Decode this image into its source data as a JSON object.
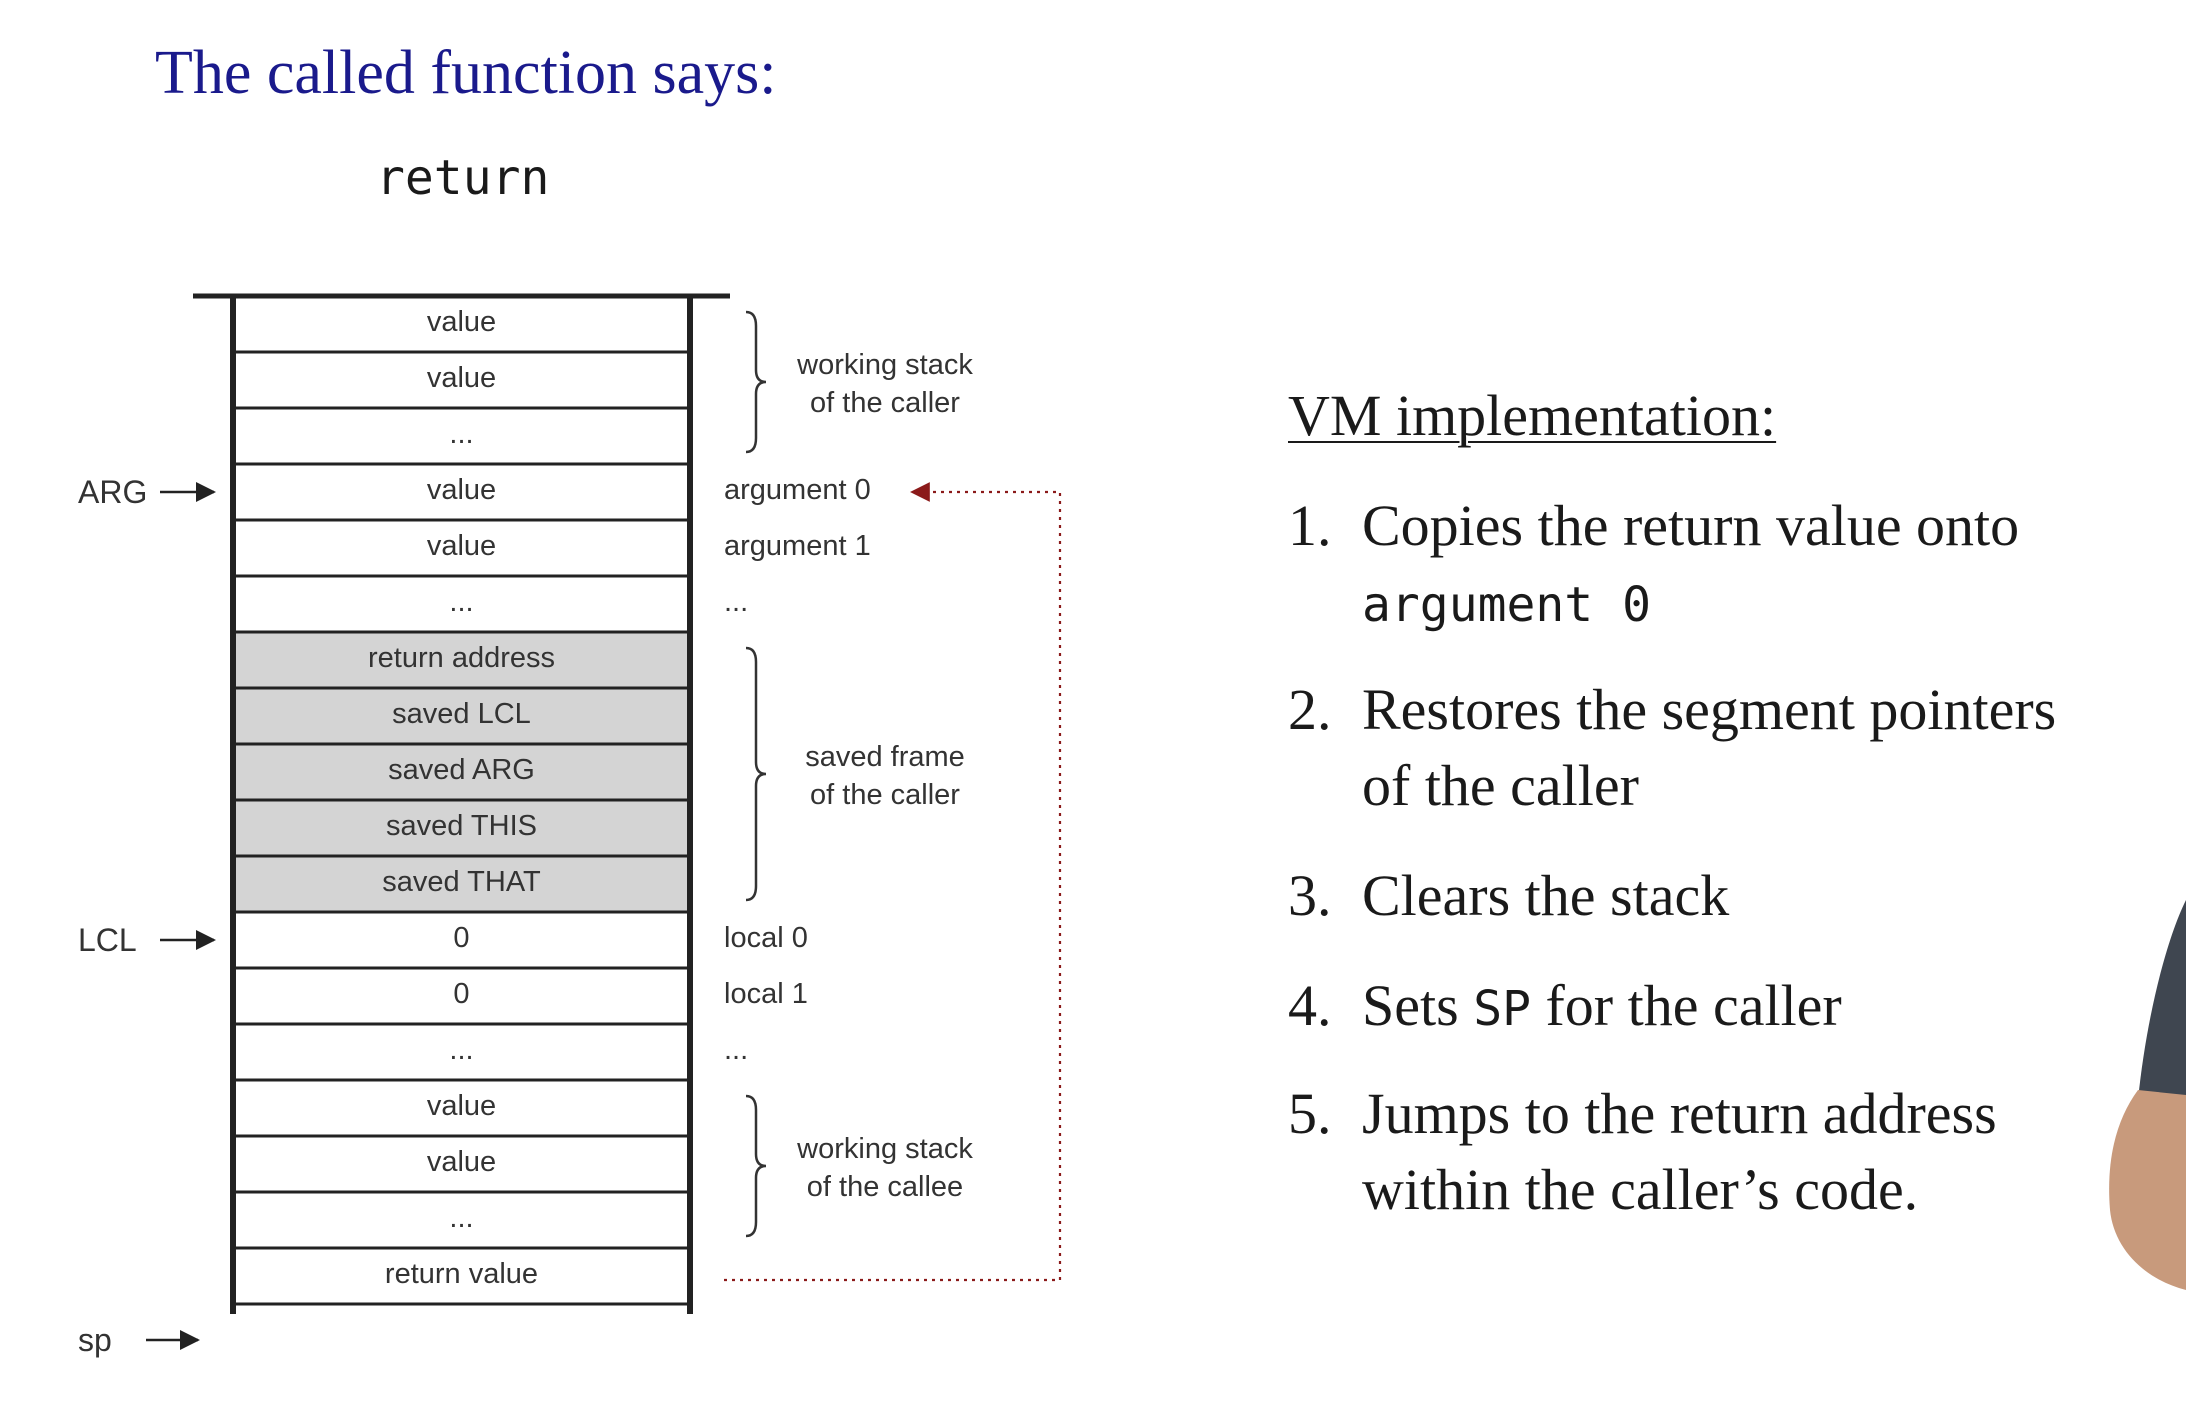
{
  "title": "The called function says:",
  "keyword": "return",
  "stack": {
    "cells": [
      {
        "label": "value",
        "shaded": false
      },
      {
        "label": "value",
        "shaded": false
      },
      {
        "label": "...",
        "shaded": false
      },
      {
        "label": "value",
        "shaded": false
      },
      {
        "label": "value",
        "shaded": false
      },
      {
        "label": "...",
        "shaded": false
      },
      {
        "label": "return address",
        "shaded": true
      },
      {
        "label": "saved LCL",
        "shaded": true
      },
      {
        "label": "saved ARG",
        "shaded": true
      },
      {
        "label": "saved THIS",
        "shaded": true
      },
      {
        "label": "saved THAT",
        "shaded": true
      },
      {
        "label": "0",
        "shaded": false
      },
      {
        "label": "0",
        "shaded": false
      },
      {
        "label": "...",
        "shaded": false
      },
      {
        "label": "value",
        "shaded": false
      },
      {
        "label": "value",
        "shaded": false
      },
      {
        "label": "...",
        "shaded": false
      },
      {
        "label": "return value",
        "shaded": false
      }
    ],
    "shade_color": "#d4d4d4"
  },
  "pointers": [
    {
      "label": "ARG",
      "row": 3
    },
    {
      "label": "LCL",
      "row": 11
    },
    {
      "label": "sp",
      "row": 18
    }
  ],
  "row_labels": [
    {
      "label": "argument 0",
      "row": 3
    },
    {
      "label": "argument 1",
      "row": 4
    },
    {
      "label": "...",
      "row": 5
    },
    {
      "label": "local 0",
      "row": 11
    },
    {
      "label": "local 1",
      "row": 12
    },
    {
      "label": "...",
      "row": 13
    }
  ],
  "brace_groups": [
    {
      "lines": [
        "working stack",
        "of the caller"
      ],
      "from_row": 0,
      "to_row": 2
    },
    {
      "lines": [
        "saved frame",
        "of the caller"
      ],
      "from_row": 6,
      "to_row": 10
    },
    {
      "lines": [
        "working stack",
        "of the callee"
      ],
      "from_row": 14,
      "to_row": 16
    }
  ],
  "copy_arrow_color": "#8b1a1a",
  "vm": {
    "heading": "VM implementation:",
    "steps": [
      {
        "num": "1.",
        "line1": "Copies the return value onto",
        "line2": "argument 0"
      },
      {
        "num": "2.",
        "line1": "Restores the segment pointers",
        "line2": "of the caller"
      },
      {
        "num": "3.",
        "line1": "Clears the stack"
      },
      {
        "num": "4.",
        "line1_pre": "Sets ",
        "line1_code": "SP",
        "line1_post": " for the caller"
      },
      {
        "num": "5.",
        "line1": "Jumps to the return address",
        "line2": "within the caller’s code."
      }
    ]
  }
}
